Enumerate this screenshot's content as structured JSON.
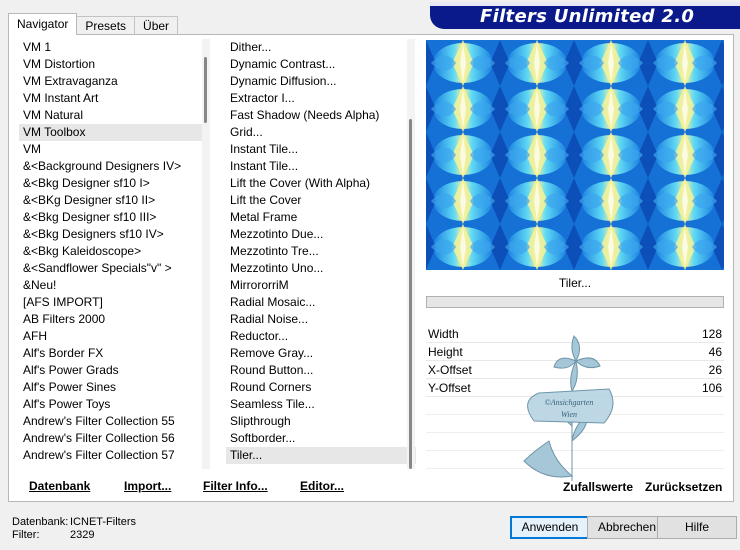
{
  "tabs": [
    "Navigator",
    "Presets",
    "Über"
  ],
  "banner_title": "Filters Unlimited 2.0",
  "categories": [
    "VM 1",
    "VM Distortion",
    "VM Extravaganza",
    "VM Instant Art",
    "VM Natural",
    "VM Toolbox",
    "VM",
    "&<Background Designers IV>",
    "&<Bkg Designer sf10 I>",
    "&<BKg Designer sf10 II>",
    "&<Bkg Designer sf10 III>",
    "&<Bkg Designers sf10 IV>",
    "&<Bkg Kaleidoscope>",
    "&<Sandflower Specials\"v\" >",
    "&Neu!",
    "[AFS IMPORT]",
    "AB Filters 2000",
    "AFH",
    "Alf's Border FX",
    "Alf's Power Grads",
    "Alf's Power Sines",
    "Alf's Power Toys",
    "Andrew's Filter Collection 55",
    "Andrew's Filter Collection 56",
    "Andrew's Filter Collection 57"
  ],
  "selected_category": "VM Toolbox",
  "filters": [
    "Dither...",
    "Dynamic Contrast...",
    "Dynamic Diffusion...",
    "Extractor I...",
    "Fast Shadow (Needs Alpha)",
    "Grid...",
    "Instant Tile...",
    "Instant Tile...",
    "Lift the Cover (With Alpha)",
    "Lift the Cover",
    "Metal Frame",
    "Mezzotinto Due...",
    "Mezzotinto Tre...",
    "Mezzotinto Uno...",
    "MirrororriM",
    "Radial Mosaic...",
    "Radial Noise...",
    "Reductor...",
    "Remove Gray...",
    "Round Button...",
    "Round Corners",
    "Seamless Tile...",
    "Slipthrough",
    "Softborder...",
    "Tiler..."
  ],
  "selected_filter": "Tiler...",
  "preview_caption": "Tiler...",
  "params": [
    {
      "name": "Width",
      "value": "128"
    },
    {
      "name": "Height",
      "value": "46"
    },
    {
      "name": "X-Offset",
      "value": "26"
    },
    {
      "name": "Y-Offset",
      "value": "106"
    }
  ],
  "watermark_text": [
    "©Ansichgarten",
    "Wien"
  ],
  "links": {
    "datenbank": "Datenbank",
    "import": "Import...",
    "filter_info": "Filter Info...",
    "editor": "Editor...",
    "zufallswerte": "Zufallswerte",
    "zuruecksetzen": "Zurücksetzen"
  },
  "status": {
    "datenbank_label": "Datenbank:",
    "datenbank_value": "ICNET-Filters",
    "filter_label": "Filter:",
    "filter_value": "2329"
  },
  "buttons": {
    "anwenden": "Anwenden",
    "abbrechen": "Abbrechen",
    "hilfe": "Hilfe"
  },
  "colors": {
    "banner_bg": "#0a1a8a",
    "preview_blue": "#1a7fe0",
    "preview_yellow": "#f6f29a",
    "preview_cyan": "#5fd8f4",
    "accent": "#0078d7"
  }
}
